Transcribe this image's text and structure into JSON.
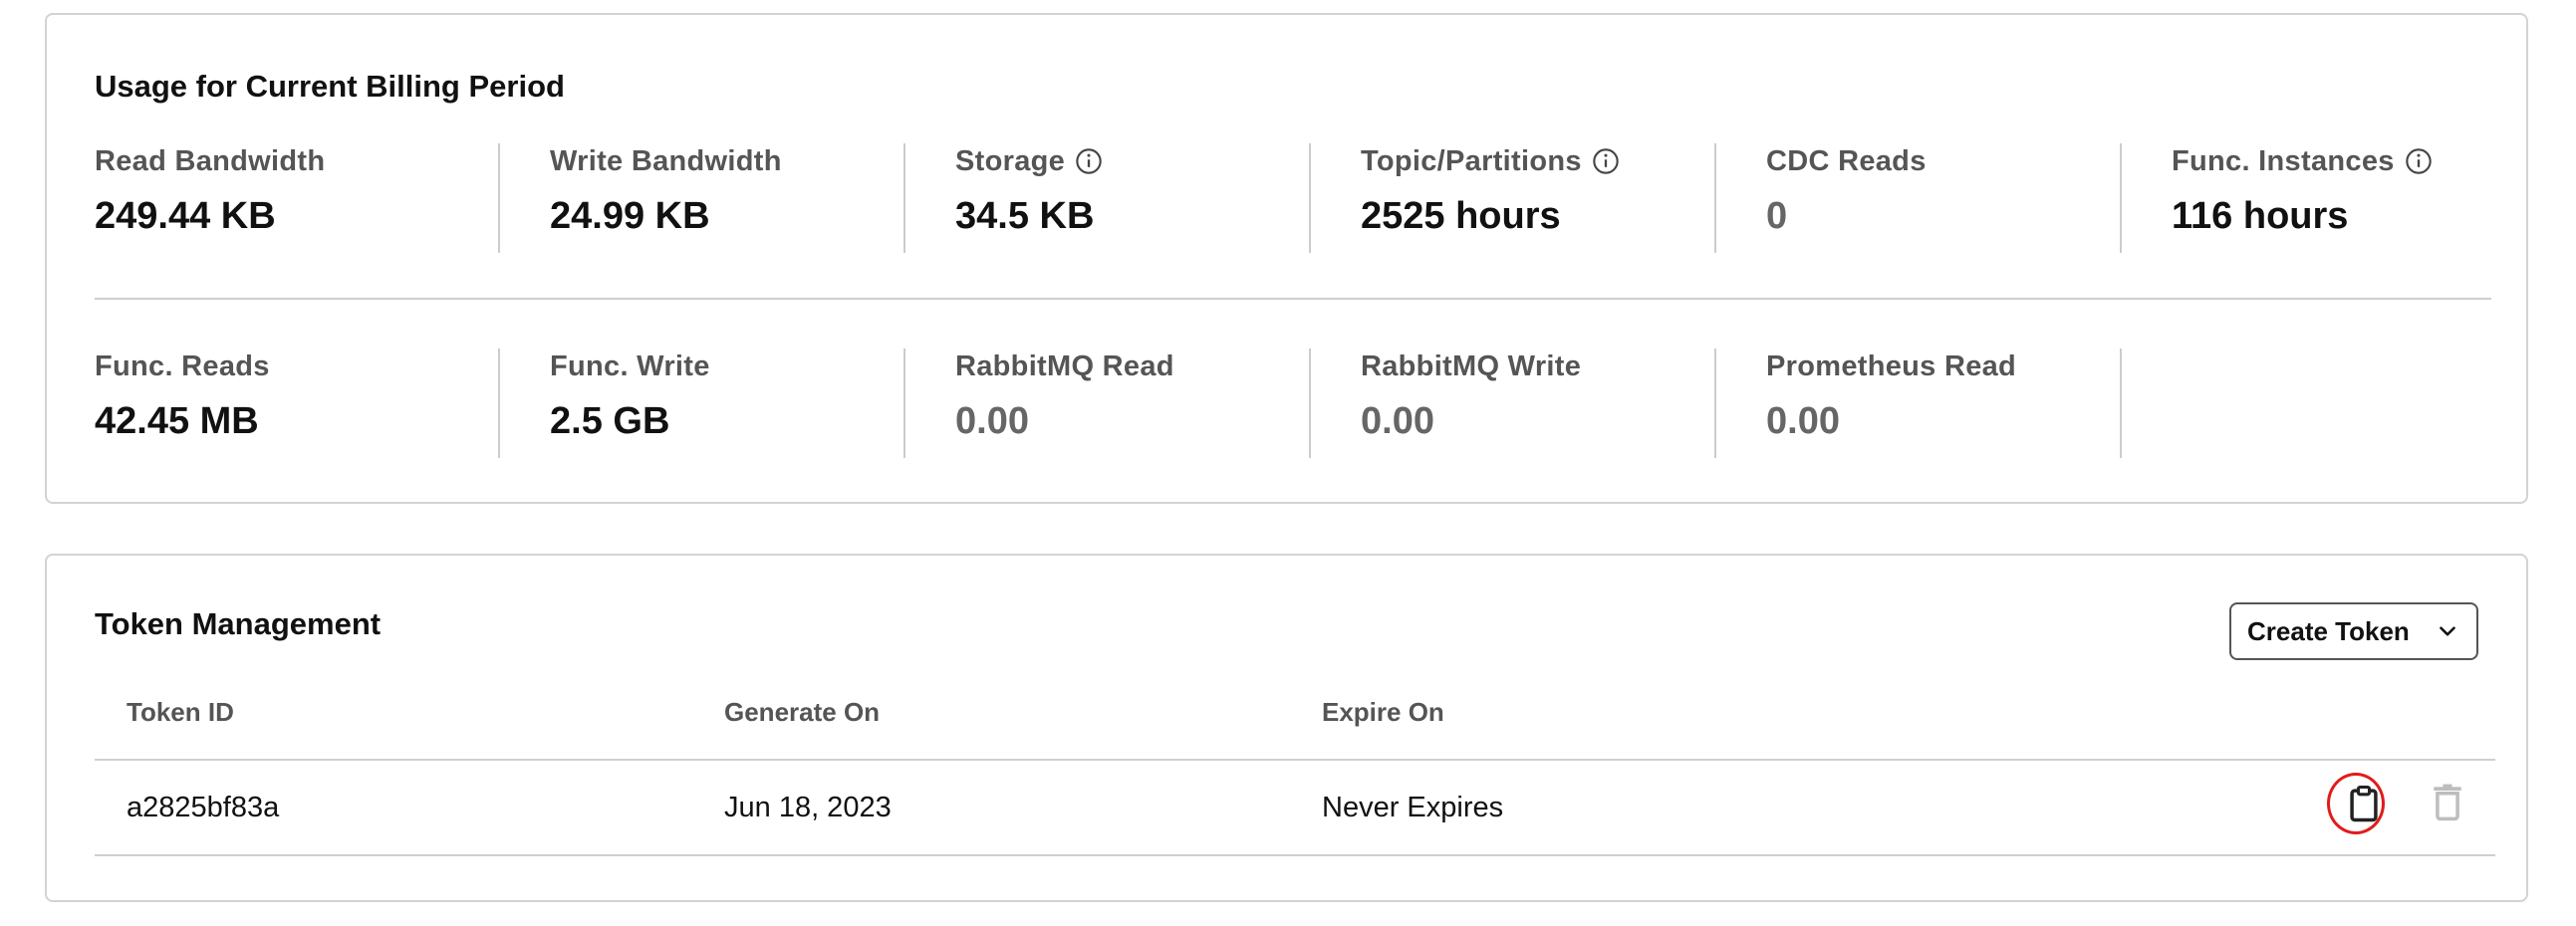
{
  "usage": {
    "title": "Usage for Current Billing Period",
    "row1": [
      {
        "label": "Read Bandwidth",
        "value": "249.44 KB",
        "info": false,
        "muted": false
      },
      {
        "label": "Write Bandwidth",
        "value": "24.99 KB",
        "info": false,
        "muted": false
      },
      {
        "label": "Storage",
        "value": "34.5 KB",
        "info": true,
        "muted": false
      },
      {
        "label": "Topic/Partitions",
        "value": "2525 hours",
        "info": true,
        "muted": false
      },
      {
        "label": "CDC Reads",
        "value": "0",
        "info": false,
        "muted": true
      },
      {
        "label": "Func. Instances",
        "value": "116 hours",
        "info": true,
        "muted": false
      }
    ],
    "row2": [
      {
        "label": "Func. Reads",
        "value": "42.45 MB",
        "info": false,
        "muted": false
      },
      {
        "label": "Func. Write",
        "value": "2.5 GB",
        "info": false,
        "muted": false
      },
      {
        "label": "RabbitMQ Read",
        "value": "0.00",
        "info": false,
        "muted": true
      },
      {
        "label": "RabbitMQ Write",
        "value": "0.00",
        "info": false,
        "muted": true
      },
      {
        "label": "Prometheus Read",
        "value": "0.00",
        "info": false,
        "muted": true
      }
    ],
    "icons": {
      "info": "info-circle-icon"
    }
  },
  "tokens": {
    "title": "Token Management",
    "create_button_label": "Create Token",
    "create_button_icon": "chevron-down-icon",
    "columns": [
      "Token ID",
      "Generate On",
      "Expire On"
    ],
    "rows": [
      {
        "token_id": "a2825bf83a",
        "generated_on": "Jun 18, 2023",
        "expire_on": "Never Expires"
      }
    ],
    "row_actions": {
      "copy_icon": "clipboard-icon",
      "delete_icon": "trash-icon"
    },
    "highlight_color": "#e21a1a"
  }
}
